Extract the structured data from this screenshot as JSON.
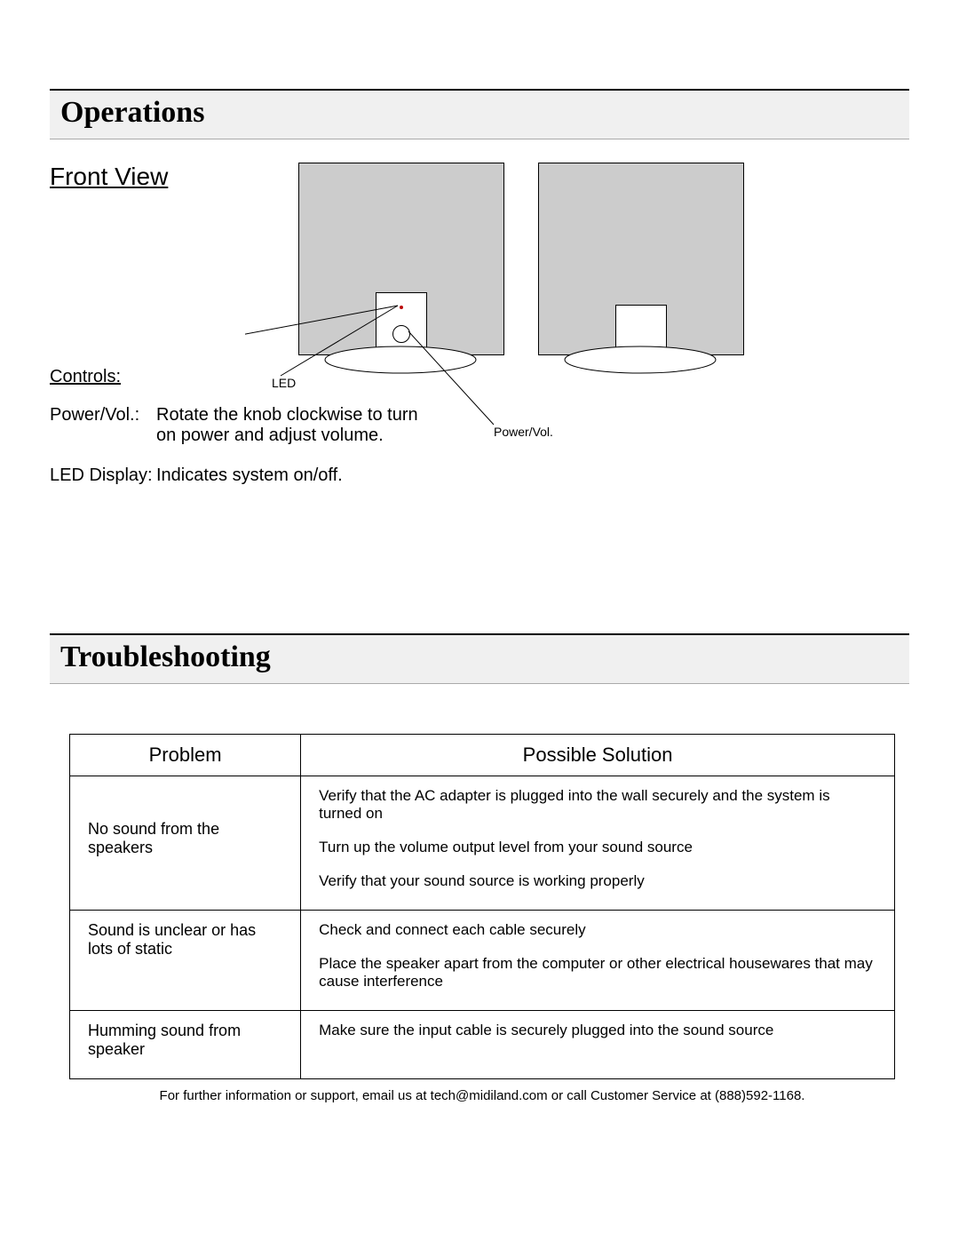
{
  "operations": {
    "heading": "Operations",
    "front_view": "Front View",
    "diagram": {
      "led_label": "LED",
      "power_label": "Power/Vol."
    },
    "controls_heading": "Controls:",
    "controls": [
      {
        "label": "Power/Vol.:",
        "desc": "Rotate the knob clockwise to turn on power and adjust volume."
      },
      {
        "label": "LED Display:",
        "desc": "Indicates system on/off."
      }
    ]
  },
  "troubleshooting": {
    "heading": "Troubleshooting",
    "columns": {
      "problem": "Problem",
      "solution": "Possible Solution"
    },
    "rows": [
      {
        "problem": "No sound from the speakers",
        "solutions": [
          "Verify that the AC adapter is plugged into the wall securely and the system is turned on",
          "Turn up the volume output level from your sound source",
          "Verify that your sound source is working properly"
        ]
      },
      {
        "problem": "Sound is unclear or has lots of static",
        "solutions": [
          "Check and connect each cable securely",
          "Place the speaker apart from the computer or other electrical housewares that may cause interference"
        ]
      },
      {
        "problem": "Humming sound from speaker",
        "solutions": [
          "Make sure the input cable is securely plugged into the sound source"
        ]
      }
    ],
    "footer": "For further information or support, email us at tech@midiland.com or call Customer Service at (888)592-1168."
  }
}
